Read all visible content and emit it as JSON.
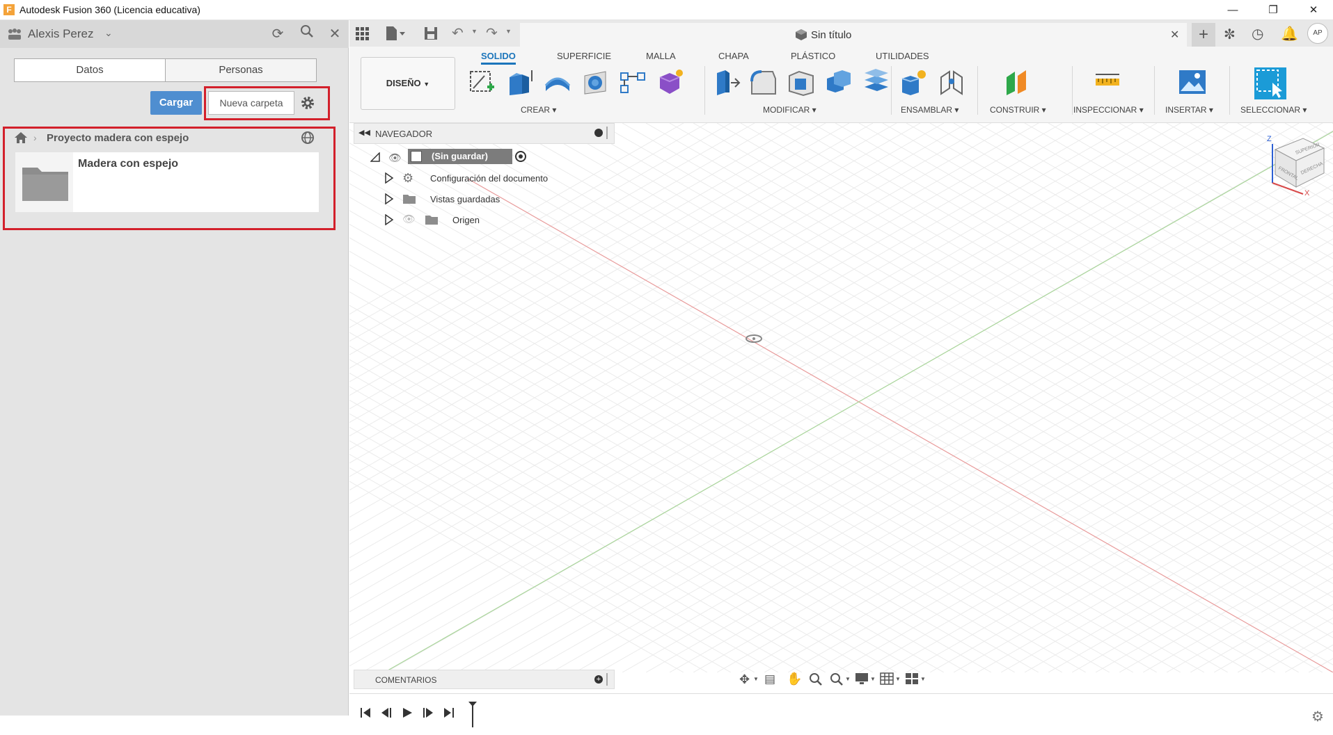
{
  "window": {
    "title": "Autodesk Fusion 360 (Licencia educativa)",
    "logo_letter": "F"
  },
  "left_panel": {
    "user": "Alexis Perez",
    "tabs": [
      "Datos",
      "Personas"
    ],
    "upload_button": "Cargar",
    "new_folder_button": "Nueva carpeta",
    "breadcrumb_project": "Proyecto madera con espejo",
    "folder_name": "Madera con espejo"
  },
  "document": {
    "title": "Sin título",
    "user_initials": "AP"
  },
  "workspace": {
    "label": "DISEÑO"
  },
  "toolbar_tabs": [
    "SOLIDO",
    "SUPERFICIE",
    "MALLA",
    "CHAPA",
    "PLÁSTICO",
    "UTILIDADES"
  ],
  "toolbar_groups": [
    "CREAR",
    "MODIFICAR",
    "ENSAMBLAR",
    "CONSTRUIR",
    "INSPECCIONAR",
    "INSERTAR",
    "SELECCIONAR"
  ],
  "browser": {
    "title": "NAVEGADOR",
    "root": "(Sin guardar)",
    "items": [
      "Configuración del documento",
      "Vistas guardadas",
      "Origen"
    ]
  },
  "comments": {
    "title": "COMENTARIOS"
  },
  "viewcube": {
    "z": "Z",
    "x": "X",
    "top": "SUPERIOR",
    "front": "FRONTAL",
    "right": "DERECHA"
  },
  "colors": {
    "accent": "#1b75bb",
    "highlight": "#d3202b",
    "upload": "#4f8ed0"
  }
}
